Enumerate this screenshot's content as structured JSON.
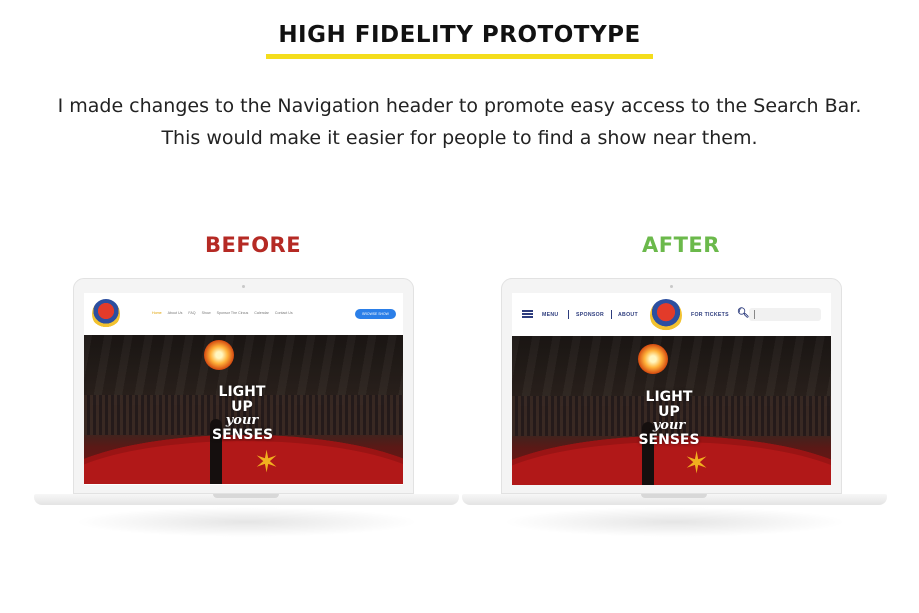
{
  "header": {
    "title": "HIGH FIDELITY PROTOTYPE",
    "description": "I made changes to the Navigation header to promote easy access to the Search Bar. This would make it easier for people to find a show near them."
  },
  "before": {
    "label": "BEFORE",
    "nav_links": [
      "Home",
      "About Us",
      "FAQ",
      "Show",
      "Sponsor The Circus",
      "Calendar",
      "Contact Us"
    ],
    "browse_button": "BROWSE SHOW",
    "hero": {
      "line1": "LIGHT UP",
      "line2": "your",
      "line3": "SENSES"
    }
  },
  "after": {
    "label": "AFTER",
    "nav": {
      "menu": "MENU",
      "sponsor": "SPONSOR",
      "about": "ABOUT",
      "tickets": "FOR TICKETS"
    },
    "search_icon": "search-icon",
    "hero": {
      "line1": "LIGHT UP",
      "line2": "your",
      "line3": "SENSES"
    }
  },
  "colors": {
    "before_label": "#b52a24",
    "after_label": "#6bb94b",
    "title_underline": "#f4dd1c",
    "nav_blue": "#2d3c7d",
    "browse_button": "#2b7fe8"
  }
}
